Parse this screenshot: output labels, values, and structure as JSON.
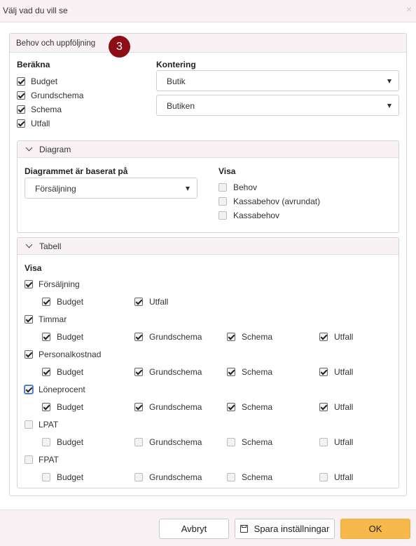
{
  "dialog": {
    "title": "Välj vad du vill se",
    "close_symbol": "×"
  },
  "main_panel": {
    "title": "Behov och uppföljning",
    "step_badge": "3"
  },
  "berakna": {
    "heading": "Beräkna",
    "items": [
      {
        "label": "Budget",
        "checked": true
      },
      {
        "label": "Grundschema",
        "checked": true
      },
      {
        "label": "Schema",
        "checked": true
      },
      {
        "label": "Utfall",
        "checked": true
      }
    ]
  },
  "kontering": {
    "heading": "Kontering",
    "select1": "Butik",
    "select2": "Butiken"
  },
  "diagram": {
    "title": "Diagram",
    "based_on_label": "Diagrammet är baserat på",
    "based_on_value": "Försäljning",
    "visa_heading": "Visa",
    "visa_items": [
      {
        "label": "Behov",
        "checked": false
      },
      {
        "label": "Kassabehov (avrundat)",
        "checked": false
      },
      {
        "label": "Kassabehov",
        "checked": false
      }
    ]
  },
  "tabell": {
    "title": "Tabell",
    "visa_heading": "Visa",
    "groups": [
      {
        "label": "Försäljning",
        "checked": true,
        "subs": [
          {
            "label": "Budget",
            "checked": true
          },
          {
            "label": "Utfall",
            "checked": true
          }
        ]
      },
      {
        "label": "Timmar",
        "checked": true,
        "subs": [
          {
            "label": "Budget",
            "checked": true
          },
          {
            "label": "Grundschema",
            "checked": true
          },
          {
            "label": "Schema",
            "checked": true
          },
          {
            "label": "Utfall",
            "checked": true
          }
        ]
      },
      {
        "label": "Personalkostnad",
        "checked": true,
        "subs": [
          {
            "label": "Budget",
            "checked": true
          },
          {
            "label": "Grundschema",
            "checked": true
          },
          {
            "label": "Schema",
            "checked": true
          },
          {
            "label": "Utfall",
            "checked": true
          }
        ]
      },
      {
        "label": "Löneprocent",
        "checked": true,
        "subs": [
          {
            "label": "Budget",
            "checked": true
          },
          {
            "label": "Grundschema",
            "checked": true
          },
          {
            "label": "Schema",
            "checked": true
          },
          {
            "label": "Utfall",
            "checked": true
          }
        ]
      },
      {
        "label": "LPAT",
        "checked": false,
        "subs": [
          {
            "label": "Budget",
            "checked": false
          },
          {
            "label": "Grundschema",
            "checked": false
          },
          {
            "label": "Schema",
            "checked": false
          },
          {
            "label": "Utfall",
            "checked": false
          }
        ]
      },
      {
        "label": "FPAT",
        "checked": false,
        "subs": [
          {
            "label": "Budget",
            "checked": false
          },
          {
            "label": "Grundschema",
            "checked": false
          },
          {
            "label": "Schema",
            "checked": false
          },
          {
            "label": "Utfall",
            "checked": false
          }
        ]
      }
    ]
  },
  "footer": {
    "cancel_label": "Avbryt",
    "save_label": "Spara inställningar",
    "ok_label": "OK"
  },
  "colors": {
    "accent": "#f7b84b",
    "badge": "#8e0e15",
    "header_tint": "#f8f2f5"
  }
}
